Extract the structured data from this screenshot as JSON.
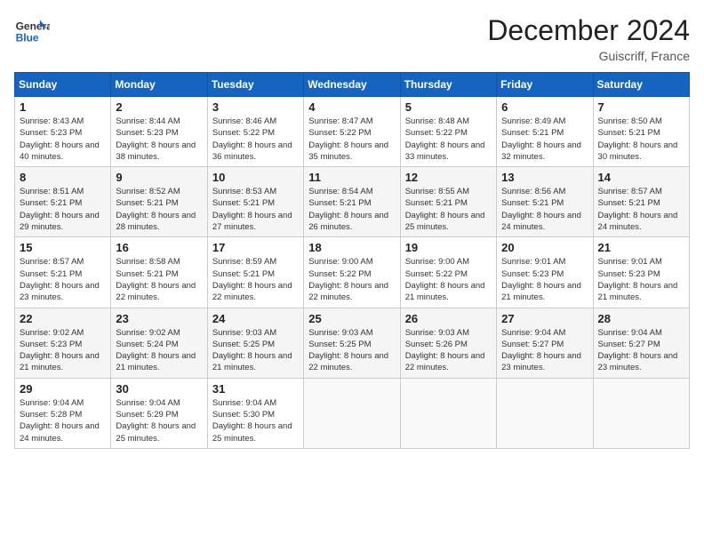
{
  "header": {
    "logo_general": "General",
    "logo_blue": "Blue",
    "month_title": "December 2024",
    "location": "Guiscriff, France"
  },
  "weekdays": [
    "Sunday",
    "Monday",
    "Tuesday",
    "Wednesday",
    "Thursday",
    "Friday",
    "Saturday"
  ],
  "weeks": [
    [
      {
        "day": "1",
        "sunrise": "8:43 AM",
        "sunset": "5:23 PM",
        "daylight": "8 hours and 40 minutes."
      },
      {
        "day": "2",
        "sunrise": "8:44 AM",
        "sunset": "5:23 PM",
        "daylight": "8 hours and 38 minutes."
      },
      {
        "day": "3",
        "sunrise": "8:46 AM",
        "sunset": "5:22 PM",
        "daylight": "8 hours and 36 minutes."
      },
      {
        "day": "4",
        "sunrise": "8:47 AM",
        "sunset": "5:22 PM",
        "daylight": "8 hours and 35 minutes."
      },
      {
        "day": "5",
        "sunrise": "8:48 AM",
        "sunset": "5:22 PM",
        "daylight": "8 hours and 33 minutes."
      },
      {
        "day": "6",
        "sunrise": "8:49 AM",
        "sunset": "5:21 PM",
        "daylight": "8 hours and 32 minutes."
      },
      {
        "day": "7",
        "sunrise": "8:50 AM",
        "sunset": "5:21 PM",
        "daylight": "8 hours and 30 minutes."
      }
    ],
    [
      {
        "day": "8",
        "sunrise": "8:51 AM",
        "sunset": "5:21 PM",
        "daylight": "8 hours and 29 minutes."
      },
      {
        "day": "9",
        "sunrise": "8:52 AM",
        "sunset": "5:21 PM",
        "daylight": "8 hours and 28 minutes."
      },
      {
        "day": "10",
        "sunrise": "8:53 AM",
        "sunset": "5:21 PM",
        "daylight": "8 hours and 27 minutes."
      },
      {
        "day": "11",
        "sunrise": "8:54 AM",
        "sunset": "5:21 PM",
        "daylight": "8 hours and 26 minutes."
      },
      {
        "day": "12",
        "sunrise": "8:55 AM",
        "sunset": "5:21 PM",
        "daylight": "8 hours and 25 minutes."
      },
      {
        "day": "13",
        "sunrise": "8:56 AM",
        "sunset": "5:21 PM",
        "daylight": "8 hours and 24 minutes."
      },
      {
        "day": "14",
        "sunrise": "8:57 AM",
        "sunset": "5:21 PM",
        "daylight": "8 hours and 24 minutes."
      }
    ],
    [
      {
        "day": "15",
        "sunrise": "8:57 AM",
        "sunset": "5:21 PM",
        "daylight": "8 hours and 23 minutes."
      },
      {
        "day": "16",
        "sunrise": "8:58 AM",
        "sunset": "5:21 PM",
        "daylight": "8 hours and 22 minutes."
      },
      {
        "day": "17",
        "sunrise": "8:59 AM",
        "sunset": "5:21 PM",
        "daylight": "8 hours and 22 minutes."
      },
      {
        "day": "18",
        "sunrise": "9:00 AM",
        "sunset": "5:22 PM",
        "daylight": "8 hours and 22 minutes."
      },
      {
        "day": "19",
        "sunrise": "9:00 AM",
        "sunset": "5:22 PM",
        "daylight": "8 hours and 21 minutes."
      },
      {
        "day": "20",
        "sunrise": "9:01 AM",
        "sunset": "5:23 PM",
        "daylight": "8 hours and 21 minutes."
      },
      {
        "day": "21",
        "sunrise": "9:01 AM",
        "sunset": "5:23 PM",
        "daylight": "8 hours and 21 minutes."
      }
    ],
    [
      {
        "day": "22",
        "sunrise": "9:02 AM",
        "sunset": "5:23 PM",
        "daylight": "8 hours and 21 minutes."
      },
      {
        "day": "23",
        "sunrise": "9:02 AM",
        "sunset": "5:24 PM",
        "daylight": "8 hours and 21 minutes."
      },
      {
        "day": "24",
        "sunrise": "9:03 AM",
        "sunset": "5:25 PM",
        "daylight": "8 hours and 21 minutes."
      },
      {
        "day": "25",
        "sunrise": "9:03 AM",
        "sunset": "5:25 PM",
        "daylight": "8 hours and 22 minutes."
      },
      {
        "day": "26",
        "sunrise": "9:03 AM",
        "sunset": "5:26 PM",
        "daylight": "8 hours and 22 minutes."
      },
      {
        "day": "27",
        "sunrise": "9:04 AM",
        "sunset": "5:27 PM",
        "daylight": "8 hours and 23 minutes."
      },
      {
        "day": "28",
        "sunrise": "9:04 AM",
        "sunset": "5:27 PM",
        "daylight": "8 hours and 23 minutes."
      }
    ],
    [
      {
        "day": "29",
        "sunrise": "9:04 AM",
        "sunset": "5:28 PM",
        "daylight": "8 hours and 24 minutes."
      },
      {
        "day": "30",
        "sunrise": "9:04 AM",
        "sunset": "5:29 PM",
        "daylight": "8 hours and 25 minutes."
      },
      {
        "day": "31",
        "sunrise": "9:04 AM",
        "sunset": "5:30 PM",
        "daylight": "8 hours and 25 minutes."
      },
      null,
      null,
      null,
      null
    ]
  ]
}
